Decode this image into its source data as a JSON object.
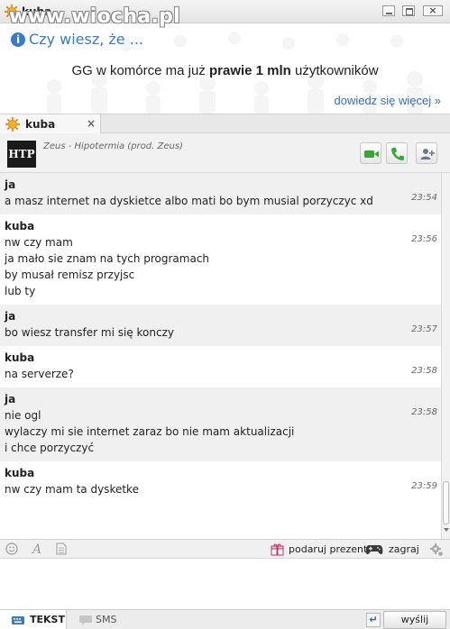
{
  "watermark": {
    "text": "www.wiocha.pl"
  },
  "window": {
    "title": "kuba"
  },
  "banner": {
    "tip": "Czy wiesz, że ...",
    "headline_before": "GG w komórce ma już ",
    "headline_bold": "prawie 1 mln",
    "headline_after": " użytkowników",
    "link": "dowiedz się więcej »"
  },
  "tab": {
    "label": "kuba",
    "close": "×"
  },
  "contact": {
    "name": "kuba",
    "avatar_text": "HTP",
    "status": "Zeus - Hipotermia (prod. Zeus)"
  },
  "messages": [
    {
      "sender": "ja",
      "time": "23:54",
      "lines": [
        "a masz internet na dyskietce albo mati bo bym musial porzyczyc xd"
      ],
      "alt": true
    },
    {
      "sender": "kuba",
      "time": "23:56",
      "lines": [
        "nw czy mam",
        "ja mało sie znam na tych programach",
        "by musał remisz przyjsc",
        "lub ty"
      ],
      "alt": false
    },
    {
      "sender": "ja",
      "time": "23:57",
      "lines": [
        "bo wiesz transfer mi się konczy"
      ],
      "alt": true
    },
    {
      "sender": "kuba",
      "time": "23:58",
      "lines": [
        "na serverze?"
      ],
      "alt": false
    },
    {
      "sender": "ja",
      "time": "23:58",
      "lines": [
        "nie ogl",
        "wylaczy mi sie internet zaraz bo nie mam aktualizacji",
        "i chce porzyczyć"
      ],
      "alt": true
    },
    {
      "sender": "kuba",
      "time": "23:59",
      "lines": [
        "nw czy mam ta dysketke"
      ],
      "alt": false
    }
  ],
  "compose_toolbar": {
    "gift_label": "podaruj prezent",
    "play_label": "zagraj"
  },
  "compose": {
    "value": ""
  },
  "bottombar": {
    "text_mode": "TEKST",
    "sms_mode": "SMS",
    "send_label": "wyślij"
  },
  "colors": {
    "link_blue": "#3a6fb8",
    "call_green": "#3aa53a",
    "message_alt_bg": "#f0f0f0"
  },
  "icons": [
    "sun-icon",
    "video-call-icon",
    "phone-icon",
    "add-contact-icon",
    "emoticon-icon",
    "font-icon",
    "file-icon",
    "gift-icon",
    "gamepad-icon",
    "settings-icon",
    "keyboard-icon",
    "sms-bubble-icon",
    "enter-icon"
  ]
}
